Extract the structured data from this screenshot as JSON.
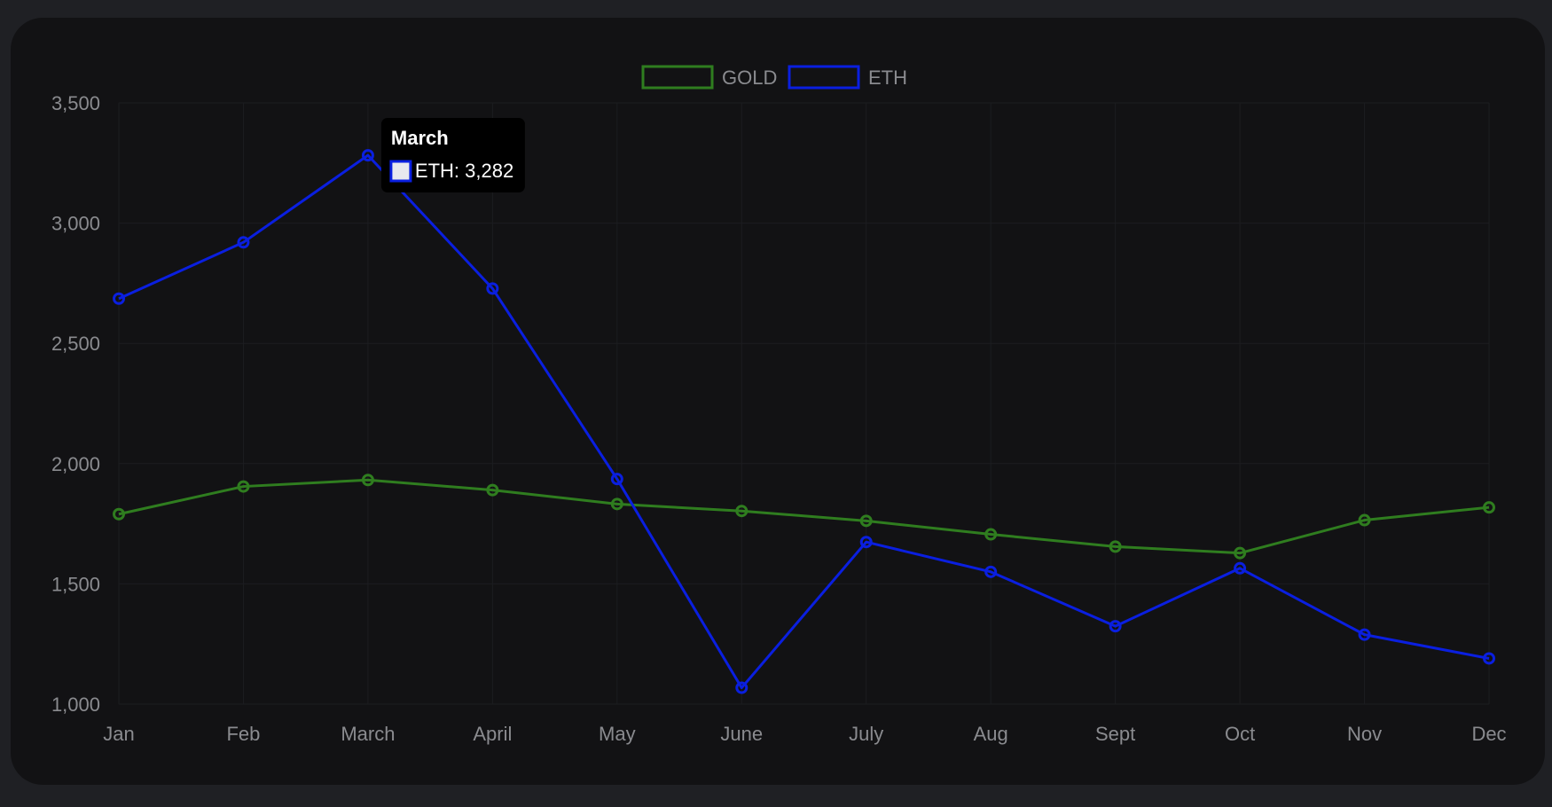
{
  "chart_data": {
    "type": "line",
    "categories": [
      "Jan",
      "Feb",
      "March",
      "April",
      "May",
      "June",
      "July",
      "Aug",
      "Sept",
      "Oct",
      "Nov",
      "Dec"
    ],
    "series": [
      {
        "name": "GOLD",
        "color": "#2f7d1f",
        "values": [
          1790,
          1905,
          1932,
          1890,
          1832,
          1803,
          1762,
          1706,
          1655,
          1628,
          1765,
          1818
        ]
      },
      {
        "name": "ETH",
        "color": "#0a1fe0",
        "values": [
          2686,
          2920,
          3282,
          2728,
          1936,
          1068,
          1674,
          1550,
          1324,
          1565,
          1289,
          1190
        ]
      }
    ],
    "ylim": [
      1000,
      3500
    ],
    "yticks": [
      1000,
      1500,
      2000,
      2500,
      3000,
      3500
    ],
    "ytick_labels": [
      "1,000",
      "1,500",
      "2,000",
      "2,500",
      "3,000",
      "3,500"
    ],
    "legend_position": "top-center",
    "grid": true,
    "title": "",
    "xlabel": "",
    "ylabel": ""
  },
  "tooltip": {
    "title": "March",
    "label": "ETH: 3,282",
    "category_index": 2,
    "series_index": 1
  },
  "colors": {
    "background": "#1f2024",
    "card": "#121214",
    "grid": "#1c1d20",
    "text": "#8a8b8f"
  }
}
